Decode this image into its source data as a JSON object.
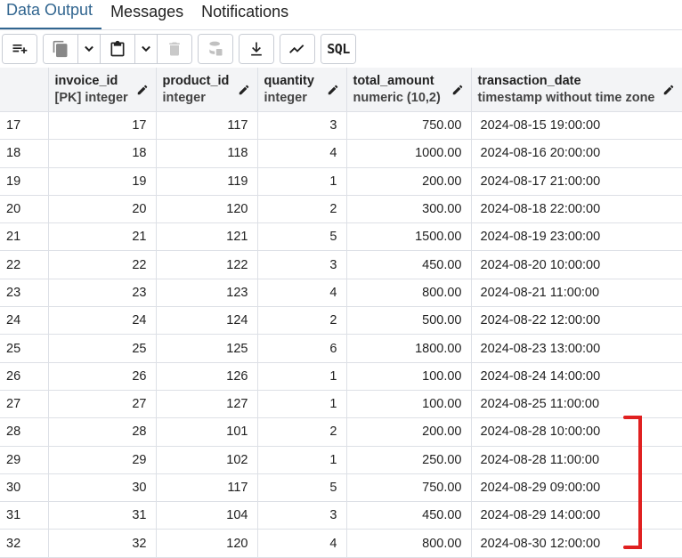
{
  "tabs": [
    "Data Output",
    "Messages",
    "Notifications"
  ],
  "toolbar": {
    "icons": [
      "add-row-icon",
      "copy-icon",
      "chevron-down-icon",
      "paste-icon",
      "chevron-down-icon",
      "delete-icon",
      "save-data-icon",
      "download-icon",
      "graph-icon"
    ],
    "sql_label": "SQL"
  },
  "columns": [
    {
      "name": "invoice_id",
      "type": "[PK] integer"
    },
    {
      "name": "product_id",
      "type": "integer"
    },
    {
      "name": "quantity",
      "type": "integer"
    },
    {
      "name": "total_amount",
      "type": "numeric (10,2)"
    },
    {
      "name": "transaction_date",
      "type": "timestamp without time zone"
    }
  ],
  "rows": [
    {
      "row": "17",
      "invoice_id": "17",
      "product_id": "117",
      "quantity": "3",
      "total_amount": "750.00",
      "transaction_date": "2024-08-15 19:00:00"
    },
    {
      "row": "18",
      "invoice_id": "18",
      "product_id": "118",
      "quantity": "4",
      "total_amount": "1000.00",
      "transaction_date": "2024-08-16 20:00:00"
    },
    {
      "row": "19",
      "invoice_id": "19",
      "product_id": "119",
      "quantity": "1",
      "total_amount": "200.00",
      "transaction_date": "2024-08-17 21:00:00"
    },
    {
      "row": "20",
      "invoice_id": "20",
      "product_id": "120",
      "quantity": "2",
      "total_amount": "300.00",
      "transaction_date": "2024-08-18 22:00:00"
    },
    {
      "row": "21",
      "invoice_id": "21",
      "product_id": "121",
      "quantity": "5",
      "total_amount": "1500.00",
      "transaction_date": "2024-08-19 23:00:00"
    },
    {
      "row": "22",
      "invoice_id": "22",
      "product_id": "122",
      "quantity": "3",
      "total_amount": "450.00",
      "transaction_date": "2024-08-20 10:00:00"
    },
    {
      "row": "23",
      "invoice_id": "23",
      "product_id": "123",
      "quantity": "4",
      "total_amount": "800.00",
      "transaction_date": "2024-08-21 11:00:00"
    },
    {
      "row": "24",
      "invoice_id": "24",
      "product_id": "124",
      "quantity": "2",
      "total_amount": "500.00",
      "transaction_date": "2024-08-22 12:00:00"
    },
    {
      "row": "25",
      "invoice_id": "25",
      "product_id": "125",
      "quantity": "6",
      "total_amount": "1800.00",
      "transaction_date": "2024-08-23 13:00:00"
    },
    {
      "row": "26",
      "invoice_id": "26",
      "product_id": "126",
      "quantity": "1",
      "total_amount": "100.00",
      "transaction_date": "2024-08-24 14:00:00"
    },
    {
      "row": "27",
      "invoice_id": "27",
      "product_id": "127",
      "quantity": "1",
      "total_amount": "100.00",
      "transaction_date": "2024-08-25 11:00:00"
    },
    {
      "row": "28",
      "invoice_id": "28",
      "product_id": "101",
      "quantity": "2",
      "total_amount": "200.00",
      "transaction_date": "2024-08-28 10:00:00"
    },
    {
      "row": "29",
      "invoice_id": "29",
      "product_id": "102",
      "quantity": "1",
      "total_amount": "250.00",
      "transaction_date": "2024-08-28 11:00:00"
    },
    {
      "row": "30",
      "invoice_id": "30",
      "product_id": "117",
      "quantity": "5",
      "total_amount": "750.00",
      "transaction_date": "2024-08-29 09:00:00"
    },
    {
      "row": "31",
      "invoice_id": "31",
      "product_id": "104",
      "quantity": "3",
      "total_amount": "450.00",
      "transaction_date": "2024-08-29 14:00:00"
    },
    {
      "row": "32",
      "invoice_id": "32",
      "product_id": "120",
      "quantity": "4",
      "total_amount": "800.00",
      "transaction_date": "2024-08-30 12:00:00"
    }
  ],
  "colors": {
    "accent": "#326690",
    "annotation": "#e02020",
    "header_bg": "#f3f4f6",
    "grid_line": "#dde0e6"
  }
}
